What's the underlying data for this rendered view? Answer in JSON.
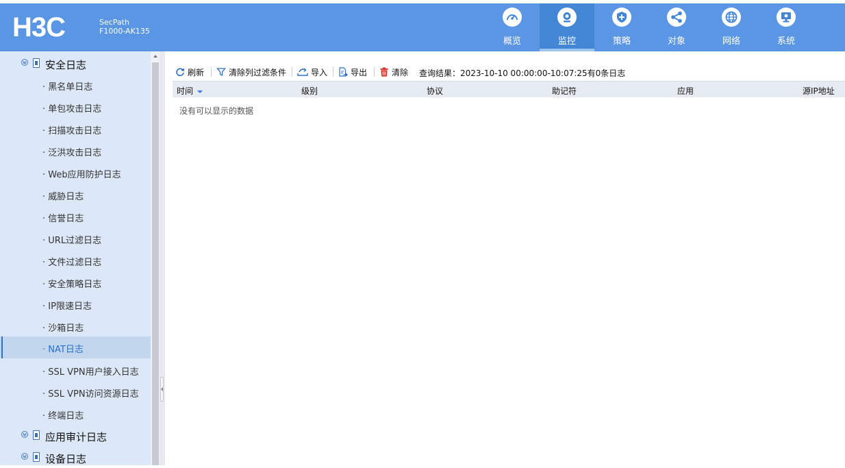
{
  "brand": {
    "logo": "H3C",
    "product_line1": "SecPath",
    "product_line2": "F1000-AK135"
  },
  "nav": [
    {
      "label": "概览",
      "icon": "gauge-icon"
    },
    {
      "label": "监控",
      "icon": "monitor-camera-icon",
      "active": true
    },
    {
      "label": "策略",
      "icon": "shield-icon"
    },
    {
      "label": "对象",
      "icon": "share-icon"
    },
    {
      "label": "网络",
      "icon": "globe-icon"
    },
    {
      "label": "系统",
      "icon": "system-monitor-icon"
    }
  ],
  "sidebar": {
    "groups": [
      {
        "label": "安全日志"
      },
      {
        "label": "应用审计日志"
      },
      {
        "label": "设备日志"
      }
    ],
    "items": [
      {
        "label": "· 黑名单日志"
      },
      {
        "label": "· 单包攻击日志"
      },
      {
        "label": "· 扫描攻击日志"
      },
      {
        "label": "· 泛洪攻击日志"
      },
      {
        "label": "· Web应用防护日志"
      },
      {
        "label": "· 威胁日志"
      },
      {
        "label": "· 信誉日志"
      },
      {
        "label": "· URL过滤日志"
      },
      {
        "label": "· 文件过滤日志"
      },
      {
        "label": "· 安全策略日志"
      },
      {
        "label": "· IP限速日志"
      },
      {
        "label": "· 沙箱日志"
      },
      {
        "label": "· NAT日志",
        "active": true
      },
      {
        "label": "· SSL VPN用户接入日志"
      },
      {
        "label": "· SSL VPN访问资源日志"
      },
      {
        "label": "· 终端日志"
      }
    ]
  },
  "toolbar": {
    "refresh": "刷新",
    "clear_filter": "清除列过滤条件",
    "import": "导入",
    "export": "导出",
    "clear": "清除",
    "query_result": "查询结果：2023-10-10 00:00:00-10:07:25有0条日志"
  },
  "table": {
    "columns": [
      "时间",
      "级别",
      "协议",
      "助记符",
      "应用",
      "源IP地址"
    ],
    "empty_text": "没有可以显示的数据"
  },
  "colors": {
    "topbar": "#5a96e3",
    "nav_active": "#4486d6",
    "sidebar": "#dce8f7",
    "sidebar_active": "#c2d6ee",
    "link_active": "#2a6fc9",
    "clear_red": "#d9251c"
  }
}
